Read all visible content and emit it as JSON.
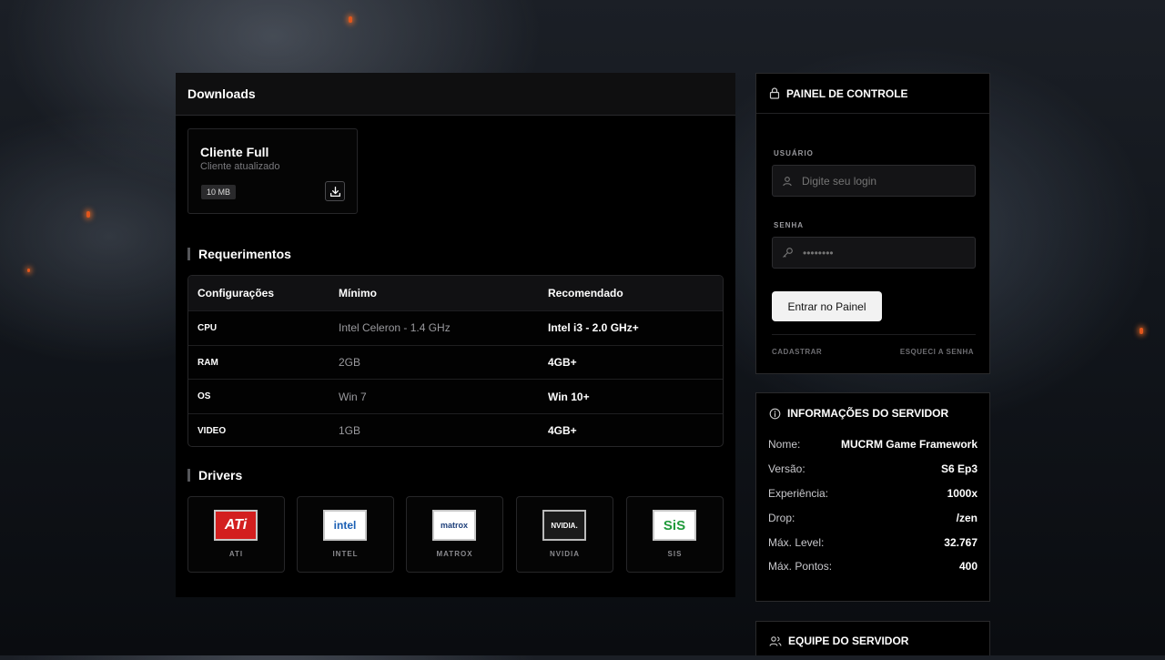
{
  "downloads": {
    "title": "Downloads",
    "file": {
      "title": "Cliente Full",
      "subtitle": "Cliente atualizado",
      "size": "10 MB",
      "icon": "download-icon"
    }
  },
  "requirements": {
    "title": "Requerimentos",
    "headers": [
      "Configurações",
      "Mínimo",
      "Recomendado"
    ],
    "rows": [
      {
        "label": "CPU",
        "min": "Intel Celeron - 1.4 GHz",
        "rec": "Intel i3 - 2.0 GHz+"
      },
      {
        "label": "RAM",
        "min": "2GB",
        "rec": "4GB+"
      },
      {
        "label": "OS",
        "min": "Win 7",
        "rec": "Win 10+"
      },
      {
        "label": "VIDEO",
        "min": "1GB",
        "rec": "4GB+"
      }
    ]
  },
  "drivers": {
    "title": "Drivers",
    "items": [
      {
        "name": "ATI",
        "logo_text": "ATi",
        "logo_bg": "#d31f1f",
        "logo_fg": "#ffffff"
      },
      {
        "name": "INTEL",
        "logo_text": "intel",
        "logo_bg": "#ffffff",
        "logo_fg": "#1a5fb4"
      },
      {
        "name": "MATROX",
        "logo_text": "matrox",
        "logo_bg": "#ffffff",
        "logo_fg": "#1d3f7a"
      },
      {
        "name": "NVIDIA",
        "logo_text": "NVIDIA.",
        "logo_bg": "#1b1b1b",
        "logo_fg": "#ffffff"
      },
      {
        "name": "SIS",
        "logo_text": "SiS",
        "logo_bg": "#ffffff",
        "logo_fg": "#1f9a3a"
      }
    ]
  },
  "panel": {
    "title": "PAINEL DE CONTROLE",
    "user_label": "USUÁRIO",
    "user_placeholder": "Digite seu login",
    "pass_label": "SENHA",
    "pass_placeholder": "••••••••",
    "login_button": "Entrar no Painel",
    "register_link": "CADASTRAR",
    "forgot_link": "ESQUECI A SENHA"
  },
  "server_info": {
    "title": "INFORMAÇÕES DO SERVIDOR",
    "rows": [
      {
        "key": "Nome:",
        "value": "MUCRM Game Framework"
      },
      {
        "key": "Versão:",
        "value": "S6 Ep3"
      },
      {
        "key": "Experiência:",
        "value": "1000x"
      },
      {
        "key": "Drop:",
        "value": "/zen"
      },
      {
        "key": "Máx. Level:",
        "value": "32.767"
      },
      {
        "key": "Máx. Pontos:",
        "value": "400"
      }
    ]
  },
  "team": {
    "title": "EQUIPE DO SERVIDOR"
  },
  "colors": {
    "panel_bg": "#000000",
    "accent_button": "#f2f2f2",
    "ember": "#e2561c"
  }
}
